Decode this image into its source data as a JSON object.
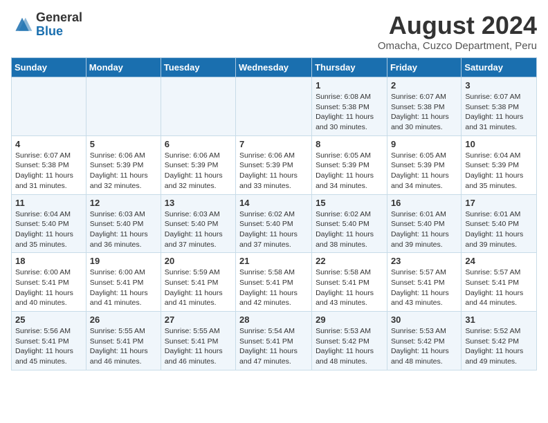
{
  "logo": {
    "general": "General",
    "blue": "Blue"
  },
  "title": "August 2024",
  "subtitle": "Omacha, Cuzco Department, Peru",
  "days_header": [
    "Sunday",
    "Monday",
    "Tuesday",
    "Wednesday",
    "Thursday",
    "Friday",
    "Saturday"
  ],
  "weeks": [
    [
      {
        "day": "",
        "content": ""
      },
      {
        "day": "",
        "content": ""
      },
      {
        "day": "",
        "content": ""
      },
      {
        "day": "",
        "content": ""
      },
      {
        "day": "1",
        "content": "Sunrise: 6:08 AM\nSunset: 5:38 PM\nDaylight: 11 hours and 30 minutes."
      },
      {
        "day": "2",
        "content": "Sunrise: 6:07 AM\nSunset: 5:38 PM\nDaylight: 11 hours and 30 minutes."
      },
      {
        "day": "3",
        "content": "Sunrise: 6:07 AM\nSunset: 5:38 PM\nDaylight: 11 hours and 31 minutes."
      }
    ],
    [
      {
        "day": "4",
        "content": "Sunrise: 6:07 AM\nSunset: 5:38 PM\nDaylight: 11 hours and 31 minutes."
      },
      {
        "day": "5",
        "content": "Sunrise: 6:06 AM\nSunset: 5:39 PM\nDaylight: 11 hours and 32 minutes."
      },
      {
        "day": "6",
        "content": "Sunrise: 6:06 AM\nSunset: 5:39 PM\nDaylight: 11 hours and 32 minutes."
      },
      {
        "day": "7",
        "content": "Sunrise: 6:06 AM\nSunset: 5:39 PM\nDaylight: 11 hours and 33 minutes."
      },
      {
        "day": "8",
        "content": "Sunrise: 6:05 AM\nSunset: 5:39 PM\nDaylight: 11 hours and 34 minutes."
      },
      {
        "day": "9",
        "content": "Sunrise: 6:05 AM\nSunset: 5:39 PM\nDaylight: 11 hours and 34 minutes."
      },
      {
        "day": "10",
        "content": "Sunrise: 6:04 AM\nSunset: 5:39 PM\nDaylight: 11 hours and 35 minutes."
      }
    ],
    [
      {
        "day": "11",
        "content": "Sunrise: 6:04 AM\nSunset: 5:40 PM\nDaylight: 11 hours and 35 minutes."
      },
      {
        "day": "12",
        "content": "Sunrise: 6:03 AM\nSunset: 5:40 PM\nDaylight: 11 hours and 36 minutes."
      },
      {
        "day": "13",
        "content": "Sunrise: 6:03 AM\nSunset: 5:40 PM\nDaylight: 11 hours and 37 minutes."
      },
      {
        "day": "14",
        "content": "Sunrise: 6:02 AM\nSunset: 5:40 PM\nDaylight: 11 hours and 37 minutes."
      },
      {
        "day": "15",
        "content": "Sunrise: 6:02 AM\nSunset: 5:40 PM\nDaylight: 11 hours and 38 minutes."
      },
      {
        "day": "16",
        "content": "Sunrise: 6:01 AM\nSunset: 5:40 PM\nDaylight: 11 hours and 39 minutes."
      },
      {
        "day": "17",
        "content": "Sunrise: 6:01 AM\nSunset: 5:40 PM\nDaylight: 11 hours and 39 minutes."
      }
    ],
    [
      {
        "day": "18",
        "content": "Sunrise: 6:00 AM\nSunset: 5:41 PM\nDaylight: 11 hours and 40 minutes."
      },
      {
        "day": "19",
        "content": "Sunrise: 6:00 AM\nSunset: 5:41 PM\nDaylight: 11 hours and 41 minutes."
      },
      {
        "day": "20",
        "content": "Sunrise: 5:59 AM\nSunset: 5:41 PM\nDaylight: 11 hours and 41 minutes."
      },
      {
        "day": "21",
        "content": "Sunrise: 5:58 AM\nSunset: 5:41 PM\nDaylight: 11 hours and 42 minutes."
      },
      {
        "day": "22",
        "content": "Sunrise: 5:58 AM\nSunset: 5:41 PM\nDaylight: 11 hours and 43 minutes."
      },
      {
        "day": "23",
        "content": "Sunrise: 5:57 AM\nSunset: 5:41 PM\nDaylight: 11 hours and 43 minutes."
      },
      {
        "day": "24",
        "content": "Sunrise: 5:57 AM\nSunset: 5:41 PM\nDaylight: 11 hours and 44 minutes."
      }
    ],
    [
      {
        "day": "25",
        "content": "Sunrise: 5:56 AM\nSunset: 5:41 PM\nDaylight: 11 hours and 45 minutes."
      },
      {
        "day": "26",
        "content": "Sunrise: 5:55 AM\nSunset: 5:41 PM\nDaylight: 11 hours and 46 minutes."
      },
      {
        "day": "27",
        "content": "Sunrise: 5:55 AM\nSunset: 5:41 PM\nDaylight: 11 hours and 46 minutes."
      },
      {
        "day": "28",
        "content": "Sunrise: 5:54 AM\nSunset: 5:41 PM\nDaylight: 11 hours and 47 minutes."
      },
      {
        "day": "29",
        "content": "Sunrise: 5:53 AM\nSunset: 5:42 PM\nDaylight: 11 hours and 48 minutes."
      },
      {
        "day": "30",
        "content": "Sunrise: 5:53 AM\nSunset: 5:42 PM\nDaylight: 11 hours and 48 minutes."
      },
      {
        "day": "31",
        "content": "Sunrise: 5:52 AM\nSunset: 5:42 PM\nDaylight: 11 hours and 49 minutes."
      }
    ]
  ]
}
